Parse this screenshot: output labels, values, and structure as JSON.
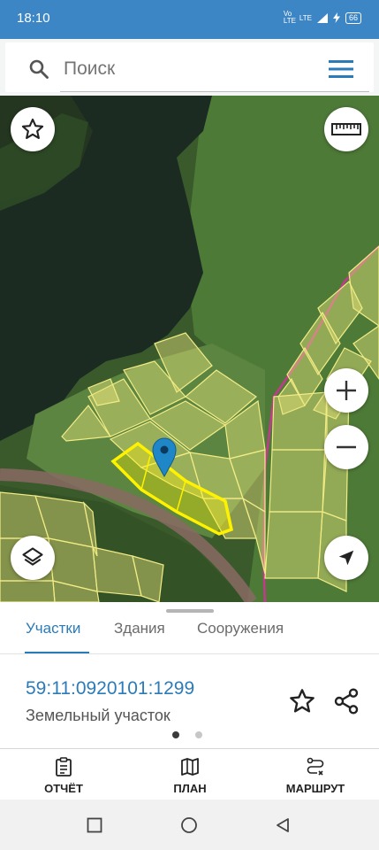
{
  "status_bar": {
    "time": "18:10",
    "network_1": "Vo LTE",
    "network_2": "LTE",
    "battery": "66"
  },
  "search": {
    "placeholder": "Поиск",
    "search_icon": "search-icon",
    "menu_icon": "hamburger-menu-icon"
  },
  "map": {
    "buttons": [
      {
        "name": "favorites",
        "icon": "star-outline-icon"
      },
      {
        "name": "measure",
        "icon": "ruler-icon"
      },
      {
        "name": "zoom-in",
        "icon": "plus-icon"
      },
      {
        "name": "zoom-out",
        "icon": "minus-icon"
      },
      {
        "name": "layers",
        "icon": "layers-icon"
      },
      {
        "name": "my-location",
        "icon": "navigation-arrow-icon"
      }
    ],
    "marker_icon": "map-pin-icon",
    "colors": {
      "parcel_fill": "#e6e27a",
      "parcel_stroke": "#f2ec86",
      "selected_stroke": "#fff200",
      "road": "#9a6f6f",
      "boundary": "#c23a8c"
    }
  },
  "sheet": {
    "tabs": [
      "Участки",
      "Здания",
      "Сооружения"
    ],
    "active_tab": 0,
    "parcel_id": "59:11:0920101:1299",
    "parcel_type": "Земельный участок",
    "page_count": 2,
    "active_page": 0
  },
  "bottom_nav": {
    "items": [
      {
        "label": "ОТЧЁТ",
        "icon": "report-clipboard-icon"
      },
      {
        "label": "ПЛАН",
        "icon": "map-plan-icon"
      },
      {
        "label": "МАРШРУТ",
        "icon": "route-icon"
      }
    ]
  },
  "system_nav": {
    "icons": [
      "recent-apps-icon",
      "home-icon",
      "back-icon"
    ]
  },
  "colors": {
    "accent": "#2b7bb9",
    "status_bar": "#3d86c6"
  }
}
